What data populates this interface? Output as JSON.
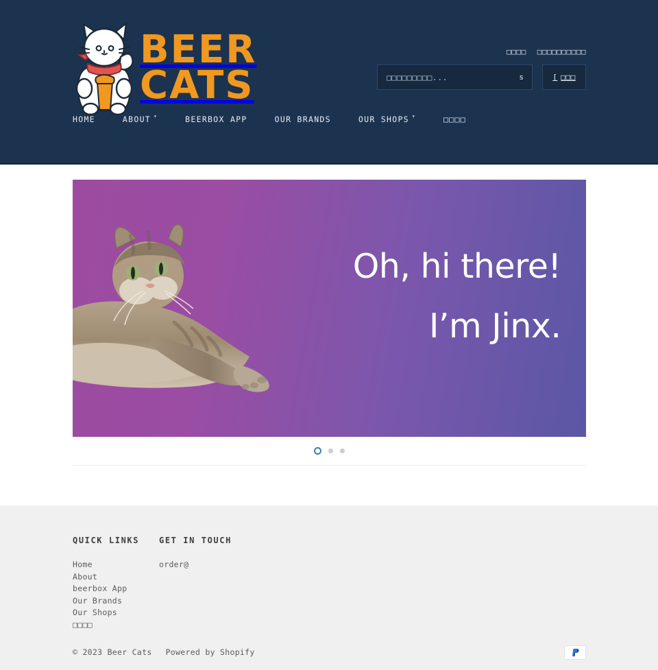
{
  "header": {
    "logo": {
      "line1": "BEER",
      "line2": "CATS",
      "icon": "maneki-neko-beer-logo",
      "color": "#f0981f"
    },
    "util_links": [
      {
        "label": "□□□□",
        "name": "account-link"
      },
      {
        "label": "□□□□□□□□□□",
        "name": "create-account-link"
      }
    ],
    "search": {
      "placeholder": "□□□□□□□□□...",
      "value": "",
      "submit_label": "s",
      "submit_icon": "search-icon"
    },
    "cart": {
      "icon": "cart-icon",
      "icon_glyph": "[",
      "label": "□□□"
    },
    "nav": [
      {
        "label": "HOME",
        "caret": "",
        "name": "nav-home"
      },
      {
        "label": "ABOUT",
        "caret": "▾",
        "name": "nav-about"
      },
      {
        "label": "BEERBOX APP",
        "caret": "",
        "name": "nav-beerbox-app"
      },
      {
        "label": "OUR BRANDS",
        "caret": "",
        "name": "nav-our-brands"
      },
      {
        "label": "OUR SHOPS",
        "caret": "▾",
        "name": "nav-our-shops"
      },
      {
        "label": "□□□□",
        "caret": "",
        "name": "nav-blog"
      }
    ]
  },
  "hero": {
    "line1": "Oh, hi there!",
    "line2": "I’m Jinx.",
    "image_alt": "tabby-cat-lying-down",
    "gradient_from": "#9c4ba0",
    "gradient_to": "#5a57a5",
    "slides": [
      {
        "active": true
      },
      {
        "active": false
      },
      {
        "active": false
      }
    ]
  },
  "footer": {
    "columns": [
      {
        "heading": "QUICK LINKS",
        "links": [
          "Home",
          "About",
          "beerbox App",
          "Our Brands",
          "Our Shops",
          "□□□□"
        ]
      },
      {
        "heading": "GET IN TOUCH",
        "links": [
          "order@"
        ]
      }
    ],
    "copyright": "© 2023 Beer Cats",
    "powered_by": "Powered by Shopify",
    "payment_icon": "paypal-icon"
  }
}
